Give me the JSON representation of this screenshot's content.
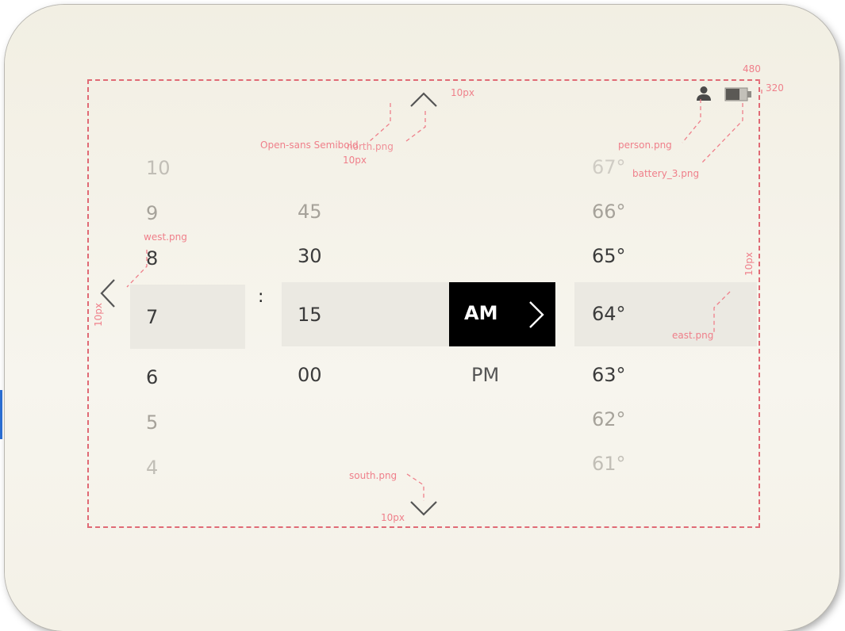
{
  "screen": {
    "width_label": "480",
    "height_label": "320"
  },
  "annotations": {
    "font_note": "Open-sans Semibold",
    "north_png": "north.png",
    "north_gap": "10px",
    "north_side_gap": "10px",
    "person_png": "person.png",
    "battery_png": "battery_3.png",
    "west_png": "west.png",
    "west_gap": "10px",
    "east_png": "east.png",
    "east_gap": "10px",
    "south_png": "south.png",
    "south_gap": "10px"
  },
  "hours": [
    "10",
    "9",
    "8",
    "7",
    "6",
    "5",
    "4"
  ],
  "selected_hour": "7",
  "colon": ":",
  "minutes": [
    "45",
    "30",
    "15",
    "00"
  ],
  "selected_minute": "15",
  "meridiem": {
    "selected": "AM",
    "other": "PM"
  },
  "temperatures": [
    "67°",
    "66°",
    "65°",
    "64°",
    "63°",
    "62°",
    "61°"
  ],
  "selected_temperature": "64°",
  "icons": {
    "up": "chevron-up-icon",
    "down": "chevron-down-icon",
    "left": "chevron-left-icon",
    "right": "chevron-right-icon",
    "person": "person-icon",
    "battery": "battery-icon"
  }
}
